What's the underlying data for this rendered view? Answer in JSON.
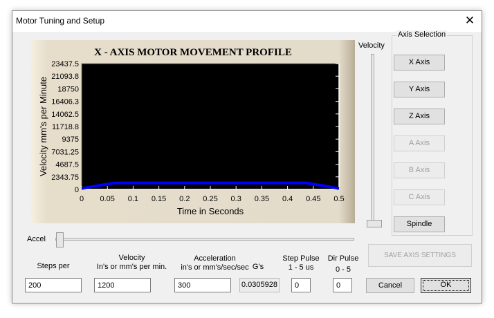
{
  "window": {
    "title": "Motor Tuning and Setup",
    "close_icon": "close-icon"
  },
  "chart_data": {
    "type": "line",
    "title": "X - AXIS MOTOR MOVEMENT PROFILE",
    "xlabel": "Time in Seconds",
    "ylabel": "Velocity mm's per Minute",
    "xlim": [
      0,
      0.5
    ],
    "ylim": [
      0,
      23437.5
    ],
    "xticks": [
      "0",
      "0.05",
      "0.1",
      "0.15",
      "0.2",
      "0.25",
      "0.3",
      "0.35",
      "0.4",
      "0.45",
      "0.5"
    ],
    "yticks": [
      "23437.5",
      "21093.8",
      "18750",
      "16406.3",
      "14062.5",
      "11718.8",
      "9375",
      "7031.25",
      "4687.5",
      "2343.75",
      "0"
    ],
    "grid": false,
    "background": "#000000",
    "series": [
      {
        "color": "#0000ff",
        "x": [
          0,
          0.01,
          0.02,
          0.03,
          0.04,
          0.05,
          0.065,
          0.435,
          0.45,
          0.46,
          0.47,
          0.48,
          0.49,
          0.5
        ],
        "y": [
          150,
          350,
          520,
          680,
          840,
          1000,
          1200,
          1200,
          1000,
          840,
          680,
          520,
          350,
          150
        ]
      }
    ]
  },
  "velocity_slider": {
    "label": "Velocity",
    "value": 0
  },
  "accel_slider": {
    "label": "Accel",
    "value": 0
  },
  "axis_selection": {
    "title": "Axis Selection",
    "buttons": [
      {
        "label": "X Axis",
        "enabled": true
      },
      {
        "label": "Y Axis",
        "enabled": true
      },
      {
        "label": "Z Axis",
        "enabled": true
      },
      {
        "label": "A Axis",
        "enabled": false
      },
      {
        "label": "B Axis",
        "enabled": false
      },
      {
        "label": "C Axis",
        "enabled": false
      },
      {
        "label": "Spindle",
        "enabled": true
      }
    ]
  },
  "fields": {
    "steps": {
      "label": "Steps per",
      "value": "200"
    },
    "velocity": {
      "label1": "Velocity",
      "label2": "In's or mm's per min.",
      "value": "1200"
    },
    "accel": {
      "label1": "Acceleration",
      "label2": "in's or mm's/sec/sec",
      "value": "300"
    },
    "gs": {
      "label": "G's",
      "value": "0.0305928"
    },
    "step_pulse": {
      "label1": "Step Pulse",
      "label2": "1 - 5 us",
      "value": "0"
    },
    "dir_pulse": {
      "label1": "Dir Pulse",
      "label2": "0 - 5",
      "value": "0"
    }
  },
  "buttons": {
    "save": "SAVE AXIS SETTINGS",
    "cancel": "Cancel",
    "ok": "OK"
  }
}
